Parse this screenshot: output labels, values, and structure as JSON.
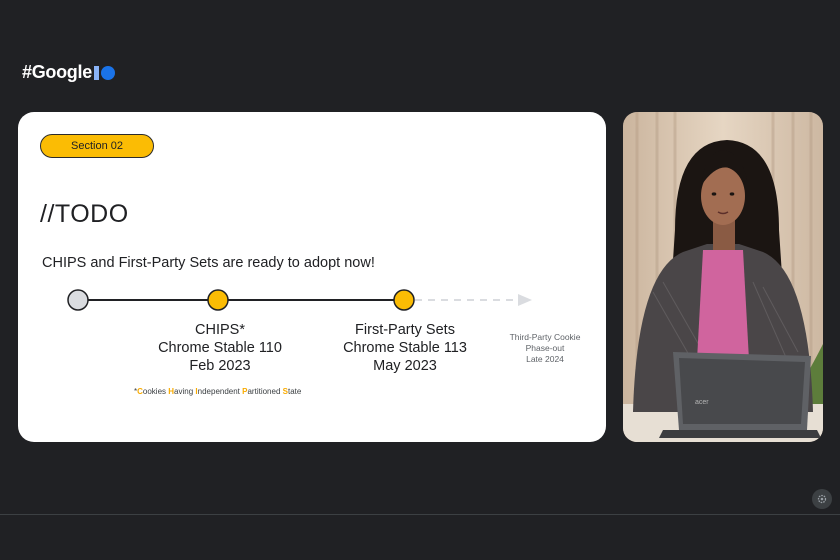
{
  "header": {
    "brand_text": "#Google"
  },
  "slide": {
    "section_label": "Section 02",
    "title": "//TODO",
    "subtitle": "CHIPS and First-Party Sets are ready to adopt now!",
    "milestones": [
      {
        "name": "CHIPS*",
        "line2": "Chrome Stable 110",
        "line3": "Feb 2023"
      },
      {
        "name": "First-Party Sets",
        "line2": "Chrome Stable 113",
        "line3": "May 2023"
      }
    ],
    "future": {
      "line1": "Third-Party Cookie",
      "line2": "Phase-out",
      "line3": "Late 2024"
    },
    "footnote": {
      "prefix": "*",
      "parts": [
        {
          "hl": "C",
          "rest": "ookies "
        },
        {
          "hl": "H",
          "rest": "aving "
        },
        {
          "hl": "I",
          "rest": "ndependent "
        },
        {
          "hl": "P",
          "rest": "artitioned "
        },
        {
          "hl": "S",
          "rest": "tate"
        }
      ]
    }
  },
  "colors": {
    "background": "#202124",
    "accent_yellow": "#fbbc04",
    "io_blue": "#1a73e8",
    "io_light_blue": "#8ab4f8",
    "start_node_gray": "#dadce0"
  },
  "icons": {
    "settings": "gear-icon",
    "io_logo": "google-io-logo-icon"
  }
}
